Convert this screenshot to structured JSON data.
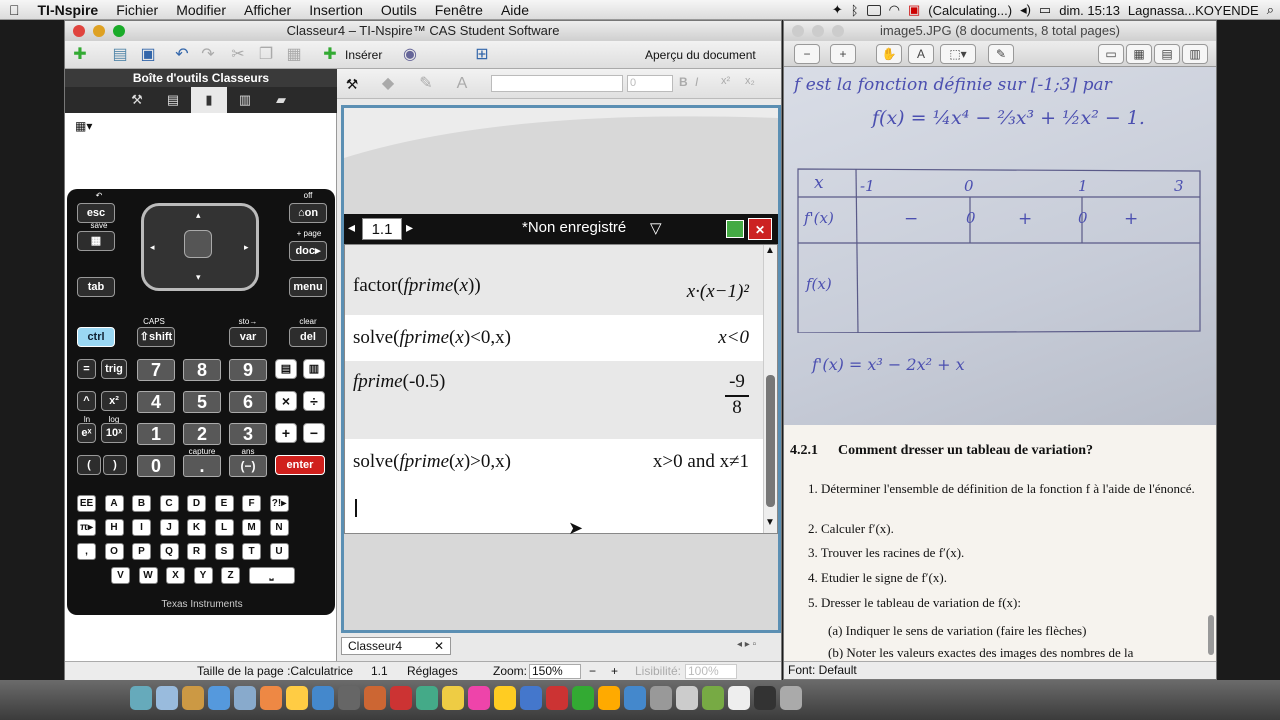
{
  "menubar": {
    "app": "TI-Nspire",
    "items": [
      "Fichier",
      "Modifier",
      "Afficher",
      "Insertion",
      "Outils",
      "Fenêtre",
      "Aide"
    ],
    "status": "(Calculating...)",
    "clock": "dim. 15:13",
    "user": "Lagnassa...KOYENDE"
  },
  "tiwindow": {
    "title": "Classeur4 – TI-Nspire™ CAS Student Software",
    "insert_label": "Insérer",
    "preview_label": "Aperçu du document",
    "toolbox_title": "Boîte d'outils Classeurs",
    "page_tab": "1.1",
    "doc_status": "*Non enregistré",
    "doc_tab": "Classeur4",
    "font_size_value": "0"
  },
  "calculator": {
    "keys": {
      "esc": "esc",
      "on": "on",
      "doc": "doc",
      "tab": "tab",
      "menu": "menu",
      "ctrl": "ctrl",
      "shift": "shift",
      "var": "var",
      "del": "del",
      "eq": "=",
      "trig": "trig",
      "caret": "^",
      "x2": "x²",
      "ex": "eˣ",
      "tenx": "10ˣ",
      "lpar": "(",
      "rpar": ")",
      "enter": "enter",
      "neg": "(−)",
      "dot": ".",
      "n7": "7",
      "n8": "8",
      "n9": "9",
      "n4": "4",
      "n5": "5",
      "n6": "6",
      "n1": "1",
      "n2": "2",
      "n3": "3",
      "n0": "0",
      "times": "×",
      "div": "÷",
      "plus": "+",
      "minus": "−"
    },
    "labels": {
      "save": "save",
      "off": "off",
      "page": "+ page",
      "caps": "CAPS",
      "sto": "sto→",
      "clear": "clear",
      "ln": "ln",
      "log": "log",
      "capture": "capture",
      "ans": "ans"
    },
    "letters": [
      [
        "EE",
        "A",
        "B",
        "C",
        "D",
        "E",
        "F",
        "?!▸"
      ],
      [
        "π▸",
        "H",
        "I",
        "J",
        "K",
        "L",
        "M",
        "N"
      ],
      [
        ",",
        "O",
        "P",
        "Q",
        "R",
        "S",
        "T",
        "U"
      ],
      [
        "V",
        "W",
        "X",
        "Y",
        "Z",
        "⎵"
      ]
    ],
    "brand": "Texas Instruments"
  },
  "calc_entries": [
    {
      "in_fn": "factor",
      "in_arg": "fprime",
      "in_var": "x",
      "in_tail": ")",
      "out": "x·(x−1)²"
    },
    {
      "in_fn": "solve",
      "in_arg": "fprime",
      "in_var": "x",
      "in_tail": "<0,x)",
      "out": "x<0"
    },
    {
      "in_fn": "",
      "in_arg": "fprime",
      "in_var": "-0.5",
      "in_tail": "",
      "out_num": "-9",
      "out_den": "8"
    },
    {
      "in_fn": "solve",
      "in_arg": "fprime",
      "in_var": "x",
      "in_tail": ">0,x)",
      "out": "x>0 and x≠1"
    }
  ],
  "statusbar": {
    "page_size": "Taille de la page :Calculatrice",
    "page": "1.1",
    "settings": "Réglages",
    "zoom_label": "Zoom:",
    "zoom": "150%",
    "readability_label": "Lisibilité:",
    "readability": "100%"
  },
  "preview": {
    "title": "image5.JPG (8 documents, 8 total pages)",
    "font_label": "Font: Default",
    "handwriting": {
      "line1": "f est la fonction définie sur [-1;3] par",
      "formula": "f(x) = ¼x⁴ − ⅔x³ + ½x² − 1.",
      "table_x": "x",
      "table_xvals": [
        "-1",
        "0",
        "1",
        "3"
      ],
      "table_fprime": "f'(x)",
      "table_signs": [
        "−",
        "0",
        "+",
        "0",
        "+"
      ],
      "table_f": "f(x)",
      "derivative": "f'(x) = x³ − 2x² + x"
    },
    "book": {
      "section": "4.2.1",
      "heading": "Comment dresser un tableau de variation?",
      "items": [
        "1. Déterminer l'ensemble de définition de la fonction f à l'aide de l'énoncé.",
        "2. Calculer f′(x).",
        "3. Trouver les racines de f′(x).",
        "4. Etudier le signe de f′(x).",
        "5. Dresser le tableau de variation de f(x):"
      ],
      "subitems": [
        "(a) Indiquer le sens de variation (faire les flèches)",
        "(b) Noter les valeurs exactes des images des nombres de la"
      ]
    }
  }
}
